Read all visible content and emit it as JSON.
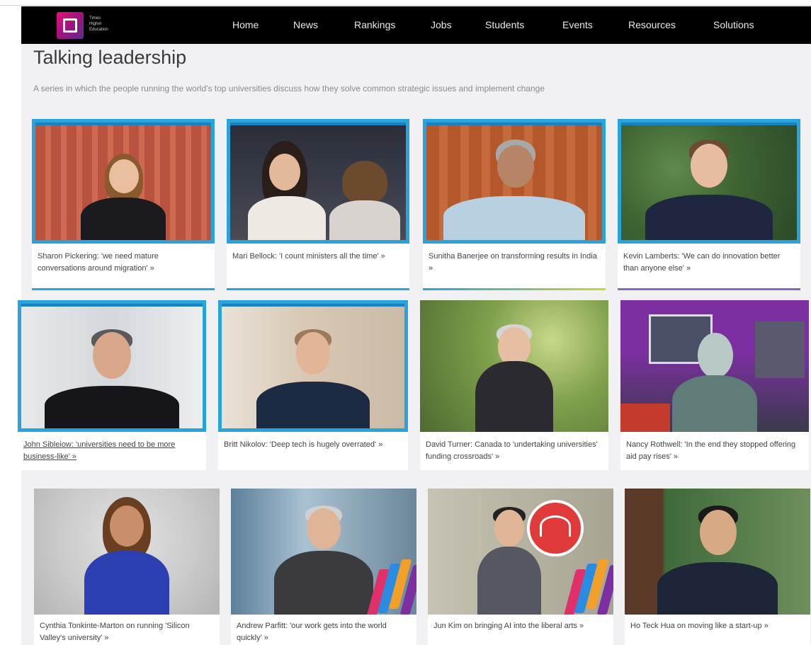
{
  "nav": {
    "logo_lines": [
      "Times",
      "Higher",
      "Education"
    ],
    "items": [
      "Home",
      "News",
      "Rankings",
      "Jobs",
      "Students",
      "Events",
      "Resources",
      "Solutions"
    ]
  },
  "page": {
    "title": "Talking leadership",
    "subtitle": "A series in which the people running the world's top universities discuss how they solve common strategic issues and implement change"
  },
  "cards": [
    {
      "caption": "Sharon Pickering: 'we need mature conversations around migration' »"
    },
    {
      "caption": "Mari Bellock: 'I count ministers all the time' »"
    },
    {
      "caption": "Sunitha Banerjee on transforming results in India »"
    },
    {
      "caption": "Kevin Lamberts: 'We can do innovation better than anyone else' »"
    },
    {
      "caption": "John Sibleiow: 'universities need to be more business-like' »"
    },
    {
      "caption": "Britt Nikolov: 'Deep tech is hugely overrated' »"
    },
    {
      "caption": "David Turner: Canada to 'undertaking universities' funding crossroads' »"
    },
    {
      "caption": "Nancy Rothwell: 'In the end they stopped offering aid pay rises' »"
    },
    {
      "caption": "Cynthia Tonkinte-Marton on running 'Silicon Valley's university' »"
    },
    {
      "caption": "Andrew Parfitt: 'our work gets into the world quickly' »"
    },
    {
      "caption": "Jun Kim on bringing AI into the liberal arts »"
    },
    {
      "caption": "Ho Teck Hua on moving like a start-up »"
    }
  ],
  "colors": {
    "frame_blue": "#29a3dc",
    "nav_bg": "#000000",
    "accent_purple": "#7b2fa0"
  }
}
